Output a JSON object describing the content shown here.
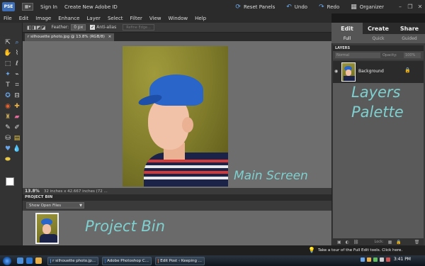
{
  "topbar": {
    "logo": "PSE",
    "workspace_btn": "▦▾",
    "sign_in": "Sign In",
    "create_id": "Create New Adobe ID",
    "reset_panels": "Reset Panels",
    "undo": "Undo",
    "redo": "Redo",
    "organizer": "Organizer"
  },
  "menu": {
    "items": [
      "File",
      "Edit",
      "Image",
      "Enhance",
      "Layer",
      "Select",
      "Filter",
      "View",
      "Window",
      "Help"
    ]
  },
  "options_bar": {
    "feather_label": "Feather:",
    "feather_value": "0 px",
    "anti_alias_label": "Anti-alias",
    "refine_edge_label": "Refine Edge..."
  },
  "document": {
    "tab_title": "r silhouette photo.jpg @ 13.8% (RGB/8)",
    "zoom": "13.8%",
    "doc_size": "32 inches x 42.667 inches (72 ..."
  },
  "project_bin": {
    "header": "PROJECT BIN",
    "dropdown": "Show Open Files"
  },
  "right_panel": {
    "tabs": [
      "Edit",
      "Create",
      "Share"
    ],
    "sub_tabs": [
      "Full",
      "Quick",
      "Guided"
    ],
    "layers_header": "LAYERS",
    "blend_mode": "Normal",
    "opacity_label": "Opacity:",
    "opacity_value": "100%",
    "layer_name": "Background",
    "lock_label": "Lock:"
  },
  "annotations": {
    "layers_line1": "Layers",
    "layers_line2": "Palette",
    "main_screen": "Main Screen",
    "project_bin": "Project Bin"
  },
  "tip": {
    "text": "Take a tour of the Full Edit tools. Click here."
  },
  "taskbar": {
    "tasks": [
      {
        "label": "r silhouette photo.jp...",
        "color": "#4c8fd8"
      },
      {
        "label": "Adobe Photoshop C...",
        "color": "#2a64b5"
      },
      {
        "label": "Edit Post ‹ Keeping ...",
        "color": "#e0612f"
      }
    ],
    "clock": "3:41 PM"
  },
  "colors": {
    "annotation": "#7fd0cf",
    "accent_blue": "#6aa6e8",
    "cap_blue": "#2a65c9"
  }
}
